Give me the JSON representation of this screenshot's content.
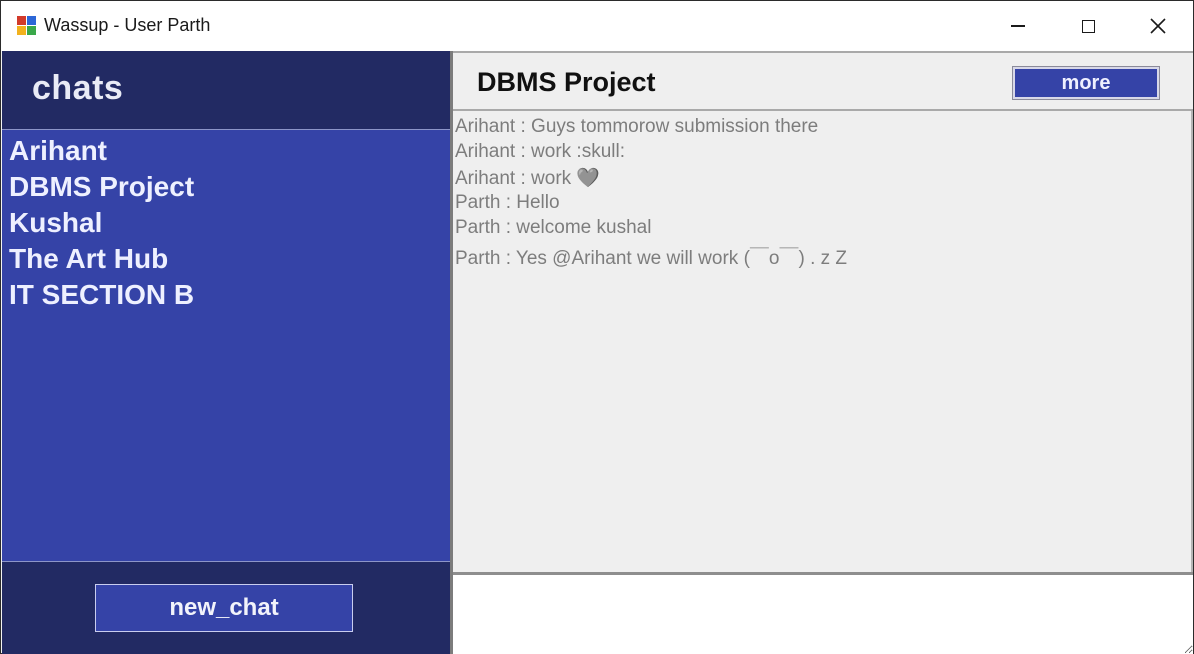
{
  "window": {
    "title": "Wassup - User Parth"
  },
  "sidebar": {
    "title": "chats",
    "chats": [
      "Arihant",
      "DBMS Project",
      "Kushal",
      "The Art Hub",
      "IT SECTION B"
    ],
    "new_chat_label": "new_chat"
  },
  "chat": {
    "name": "DBMS Project",
    "more_label": "more",
    "messages": [
      "Arihant : Guys tommorow submission there",
      "Arihant : work :skull:",
      "Arihant : work 🩶",
      "Parth : Hello",
      "Parth : welcome kushal",
      "Parth : Yes @Arihant we will work (￣o￣) . z Z"
    ],
    "input_value": ""
  },
  "colors": {
    "sidebar_dark": "#222a63",
    "sidebar_list": "#3543a7",
    "panel_bg": "#efefef",
    "message_text": "#7d7d7d"
  },
  "icons": {
    "app": "app-window-icon",
    "minimize": "minimize-icon",
    "maximize": "maximize-icon",
    "close": "close-icon"
  }
}
